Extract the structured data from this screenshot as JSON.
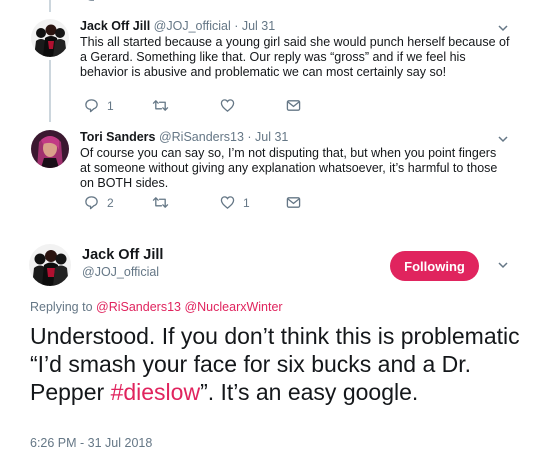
{
  "colors": {
    "accent": "#e0245e",
    "secondary_text": "#657786",
    "primary_text": "#14171a",
    "thread_line": "#ccd6dd"
  },
  "reply1": {
    "name": "Jack Off Jill",
    "meta": "@JOJ_official · Jul 31",
    "text": "This all started because a young girl said she would punch herself because of a Gerard. Something like that. Our reply was “gross” and if we feel his behavior is abusive and problematic we can most certainly say so!",
    "reply_count": "1",
    "retweet_count": "",
    "like_count": ""
  },
  "reply2": {
    "name": "Tori Sanders",
    "meta": "@RiSanders13 · Jul 31",
    "text": "Of course you can say so, I’m not disputing that, but when you point fingers at someone without giving any explanation whatsoever, it’s harmful to those on BOTH sides.",
    "reply_count": "2",
    "retweet_count": "",
    "like_count": "1"
  },
  "main": {
    "name": "Jack Off Jill",
    "handle": "@JOJ_official",
    "follow_label": "Following",
    "replying_prefix": "Replying to ",
    "mention1": "@RiSanders13",
    "mention_sep": " ",
    "mention2": "@NuclearxWinter",
    "text_before": "Understood. If you don’t think this is problematic “I’d smash your face for six bucks and a Dr. Pepper ",
    "hashtag": "#dieslow",
    "text_after": "”. It’s an easy google.",
    "timestamp": "6:26 PM - 31 Jul 2018"
  },
  "icons": {
    "reply": "reply-icon",
    "retweet": "retweet-icon",
    "like": "heart-icon",
    "dm": "envelope-icon",
    "caret": "chevron-down-icon"
  }
}
